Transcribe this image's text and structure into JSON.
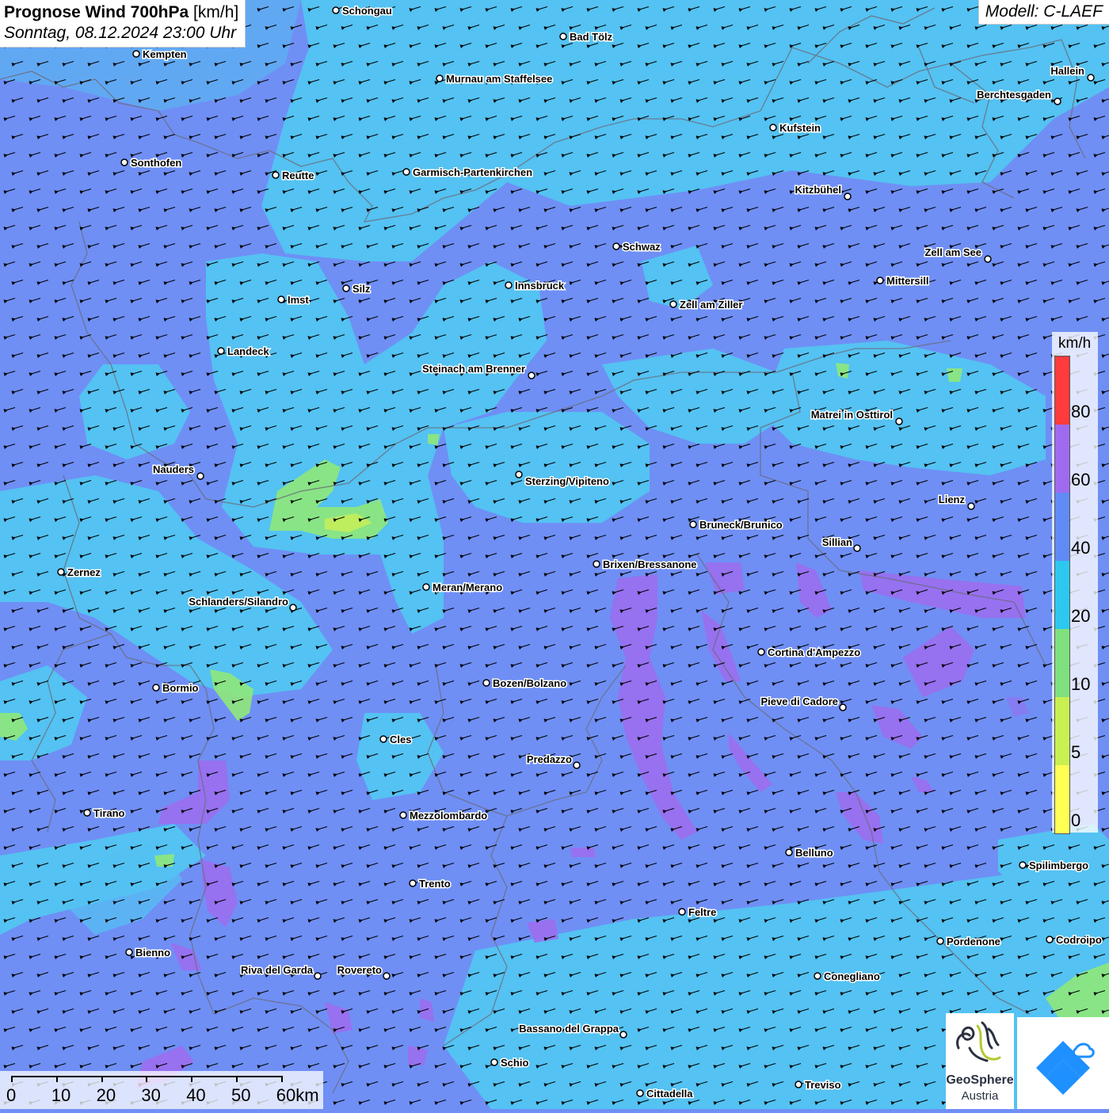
{
  "header": {
    "title_bold": "Prognose Wind 700hPa",
    "title_unit": "[km/h]",
    "datetime": "Sonntag, 08.12.2024 23:00 Uhr",
    "model": "Modell: C-LAEF"
  },
  "legend": {
    "unit": "km/h",
    "colors": [
      "#ff3b3b",
      "#a06af0",
      "#5f8bf5",
      "#2cc8f0",
      "#7ee07e",
      "#c8f050",
      "#ffff55"
    ],
    "ticks": [
      "80",
      "60",
      "40",
      "20",
      "10",
      "5",
      "0"
    ]
  },
  "scale_bar": {
    "labels": [
      "0",
      "10",
      "20",
      "30",
      "40",
      "50",
      "60km"
    ]
  },
  "logo": {
    "name_line1": "GeoSphere",
    "name_line2": "Austria"
  },
  "wind_direction_arrows": "pointing west-southwest",
  "cities": [
    {
      "name": "Schongau"
    },
    {
      "name": "Bad Tölz"
    },
    {
      "name": "Kempten"
    },
    {
      "name": "Murnau am Staffelsee"
    },
    {
      "name": "Hallein"
    },
    {
      "name": "Berchtesgaden"
    },
    {
      "name": "Kufstein"
    },
    {
      "name": "Sonthofen"
    },
    {
      "name": "Reutte"
    },
    {
      "name": "Garmisch-Partenkirchen"
    },
    {
      "name": "Kitzbühel"
    },
    {
      "name": "Schwaz"
    },
    {
      "name": "Zell am See"
    },
    {
      "name": "Mittersill"
    },
    {
      "name": "Imst"
    },
    {
      "name": "Silz"
    },
    {
      "name": "Innsbruck"
    },
    {
      "name": "Zell am Ziller"
    },
    {
      "name": "Landeck"
    },
    {
      "name": "Steinach am Brenner"
    },
    {
      "name": "Matrei in Osttirol"
    },
    {
      "name": "Nauders"
    },
    {
      "name": "Sterzing/Vipiteno"
    },
    {
      "name": "Lienz"
    },
    {
      "name": "Bruneck/Brunico"
    },
    {
      "name": "Sillian"
    },
    {
      "name": "Brixen/Bressanone"
    },
    {
      "name": "Zernez"
    },
    {
      "name": "Meran/Merano"
    },
    {
      "name": "Schlanders/Silandro"
    },
    {
      "name": "Cortina d'Ampezzo"
    },
    {
      "name": "Bozen/Bolzano"
    },
    {
      "name": "Bormio"
    },
    {
      "name": "Pieve di Cadore"
    },
    {
      "name": "Cles"
    },
    {
      "name": "Predazzo"
    },
    {
      "name": "Tirano"
    },
    {
      "name": "Mezzolombardo"
    },
    {
      "name": "Belluno"
    },
    {
      "name": "Spilimbergo"
    },
    {
      "name": "Trento"
    },
    {
      "name": "Feltre"
    },
    {
      "name": "Pordenone"
    },
    {
      "name": "Codroipo"
    },
    {
      "name": "Bienno"
    },
    {
      "name": "Riva del Garda"
    },
    {
      "name": "Rovereto"
    },
    {
      "name": "Conegliano"
    },
    {
      "name": "Bassano del Grappa"
    },
    {
      "name": "Schio"
    },
    {
      "name": "Treviso"
    },
    {
      "name": "Cittadella"
    }
  ]
}
